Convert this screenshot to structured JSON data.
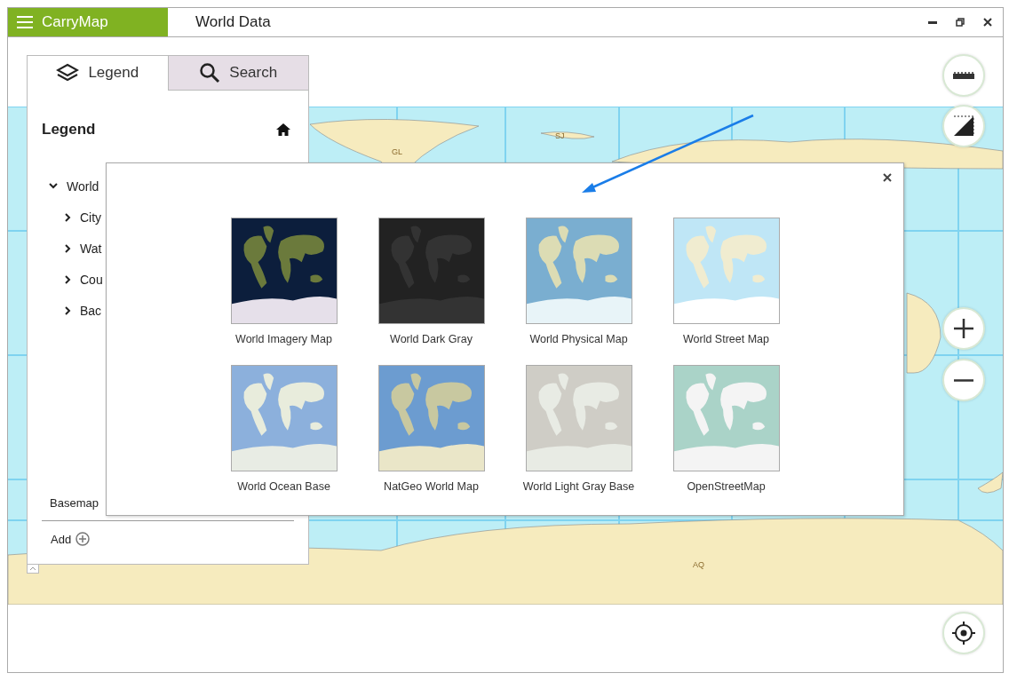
{
  "app": {
    "name": "CarryMap"
  },
  "window": {
    "title": "World Data"
  },
  "panel": {
    "tabs": [
      {
        "label": "Legend",
        "selected": true,
        "kind": "layers"
      },
      {
        "label": "Search",
        "selected": false,
        "kind": "search"
      }
    ],
    "heading": "Legend",
    "tree": [
      {
        "label": "World",
        "expanded": true,
        "children": [
          {
            "label": "City",
            "expanded": false
          },
          {
            "label": "Wat",
            "expanded": false
          },
          {
            "label": "Cou",
            "expanded": false
          },
          {
            "label": "Bac",
            "expanded": false
          }
        ]
      }
    ],
    "basemap_label": "Basemap",
    "add_label": "Add"
  },
  "map_labels": [
    "GL",
    "SJ",
    "AQ"
  ],
  "basemap_dialog": {
    "items": [
      {
        "label": "World Imagery Map"
      },
      {
        "label": "World Dark Gray"
      },
      {
        "label": "World Physical Map"
      },
      {
        "label": "World Street Map"
      },
      {
        "label": "World Ocean Base"
      },
      {
        "label": "NatGeo World Map"
      },
      {
        "label": "World Light Gray Base"
      },
      {
        "label": "OpenStreetMap"
      }
    ]
  }
}
